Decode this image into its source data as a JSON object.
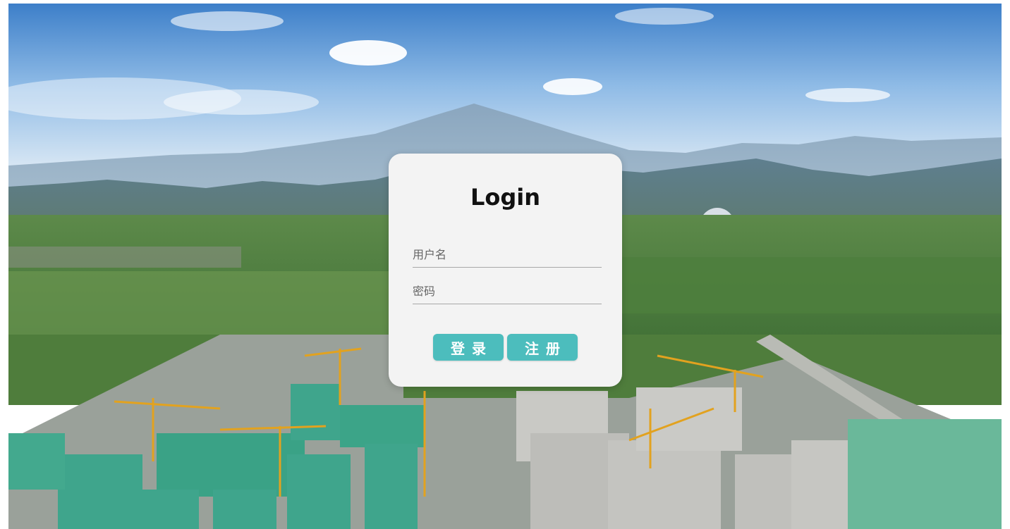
{
  "login": {
    "title": "Login",
    "username_placeholder": "用户名",
    "password_placeholder": "密码",
    "login_button": "登录",
    "register_button": "注册"
  },
  "colors": {
    "card_background": "#f3f3f3",
    "button_accent": "#4cbdbd",
    "button_text": "#ffffff"
  }
}
